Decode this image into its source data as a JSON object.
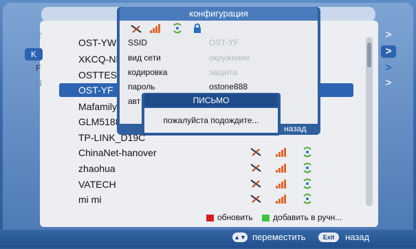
{
  "background_menu": {
    "left_letters": [
      "Т",
      "K",
      "F",
      "N"
    ],
    "networks": [
      {
        "name": "OST-YW",
        "icons": false
      },
      {
        "name": "XKCQ-NE",
        "icons": false
      },
      {
        "name": "OSTTEST",
        "icons": false
      },
      {
        "name": "OST-YF",
        "icons": false
      },
      {
        "name": "Mafamily",
        "icons": false
      },
      {
        "name": "GLM5188",
        "icons": false
      },
      {
        "name": "TP-LINK_D19C",
        "icons": false
      },
      {
        "name": "ChinaNet-hanover",
        "icons": true
      },
      {
        "name": "zhaohua",
        "icons": true
      },
      {
        "name": "VATECH",
        "icons": true
      },
      {
        "name": "mi  mi",
        "icons": true
      }
    ],
    "selected_index": 3,
    "right_chevrons": [
      ">",
      ">",
      ">",
      ">"
    ],
    "legend": {
      "refresh_label": "обновить",
      "refresh_color": "#d61e1e",
      "add_manual_label": "добавить в ручн...",
      "add_manual_color": "#3fc43a"
    }
  },
  "footer": {
    "move_key": "▲▼",
    "move_label": "переместить",
    "exit_key": "Exit",
    "exit_label": "назад"
  },
  "config_dialog": {
    "title": "конфигурация",
    "icons": [
      "tools-icon",
      "signal-icon",
      "wifi-icon",
      "lock-icon"
    ],
    "fields": [
      {
        "label": "SSID",
        "value": "OST-YF",
        "style": "dim"
      },
      {
        "label": "вид сети",
        "value": "окружение",
        "style": "dim"
      },
      {
        "label": "кодировка",
        "value": "защита",
        "style": "dim"
      },
      {
        "label": "пароль",
        "value": "ostone888",
        "style": "dark"
      },
      {
        "label": "авт",
        "value": "",
        "style": "dim"
      }
    ],
    "back_label": "назад"
  },
  "letter_dialog": {
    "title": "ПИСЬМО",
    "message": "пожалуйста подождите..."
  }
}
